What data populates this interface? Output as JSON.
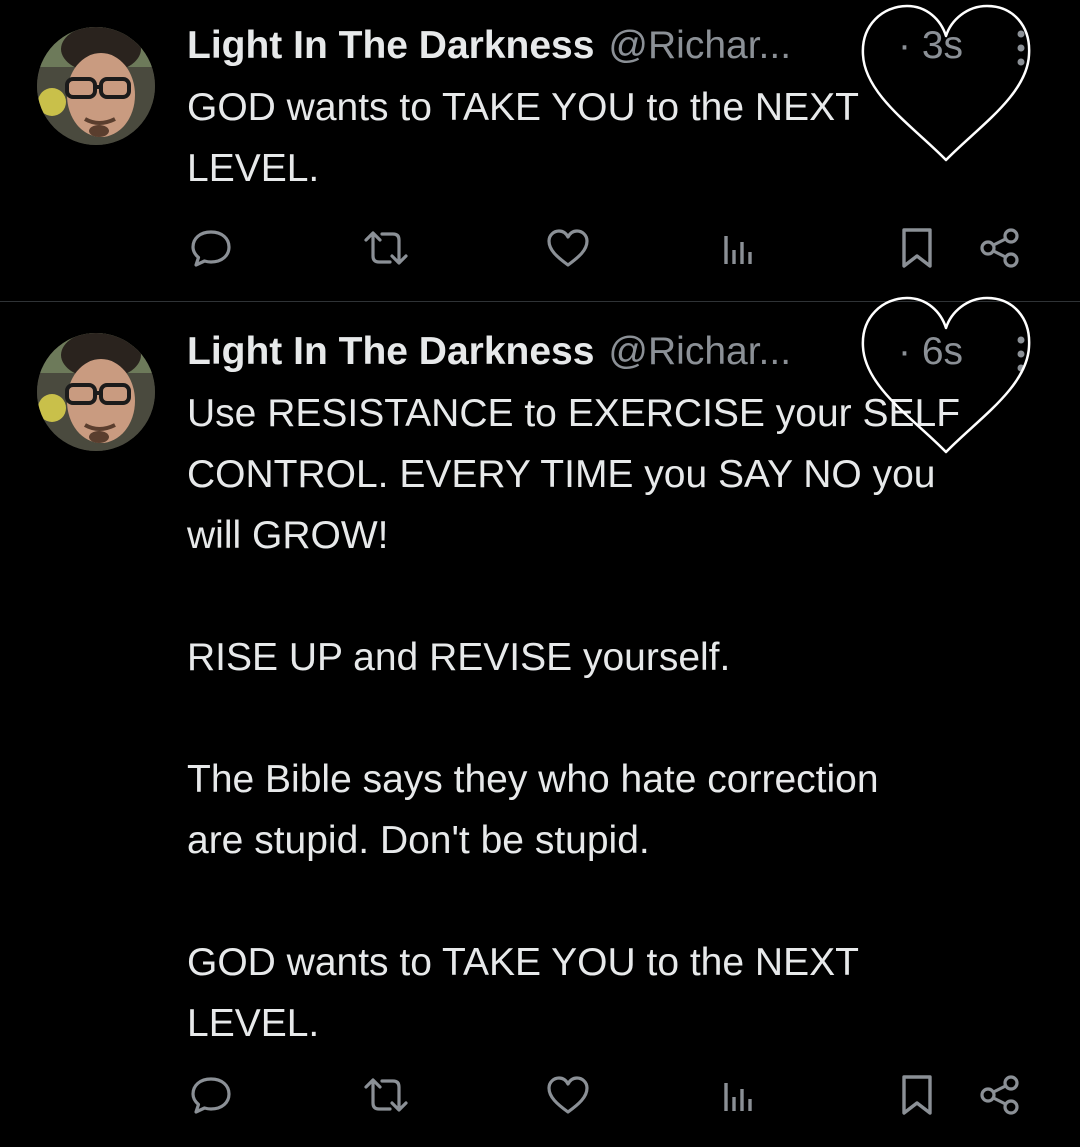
{
  "tweets": [
    {
      "display_name": "Light In The Darkness",
      "handle": "@Richar...",
      "time": "· 3s",
      "text": "GOD wants to TAKE YOU to the NEXT\nLEVEL."
    },
    {
      "display_name": "Light In The Darkness",
      "handle": "@Richar...",
      "time": "· 6s",
      "text": "Use RESISTANCE to EXERCISE your SELF\nCONTROL. EVERY TIME you SAY NO you\nwill GROW!\n\nRISE UP and REVISE yourself.\n\nThe Bible says they who hate correction\nare stupid. Don't be stupid.\n\nGOD wants to TAKE YOU to the NEXT\nLEVEL."
    }
  ],
  "icons": {
    "reply": "reply-icon",
    "retweet": "retweet-icon",
    "like": "heart-icon",
    "views": "views-icon",
    "bookmark": "bookmark-icon",
    "share": "share-icon",
    "more": "more-vertical-icon",
    "doodle": "heart-doodle-icon"
  },
  "colors": {
    "background": "#000000",
    "text": "#e7e9ea",
    "secondary": "#8b9096",
    "divider": "#2f3336",
    "doodle": "#ffffff"
  }
}
